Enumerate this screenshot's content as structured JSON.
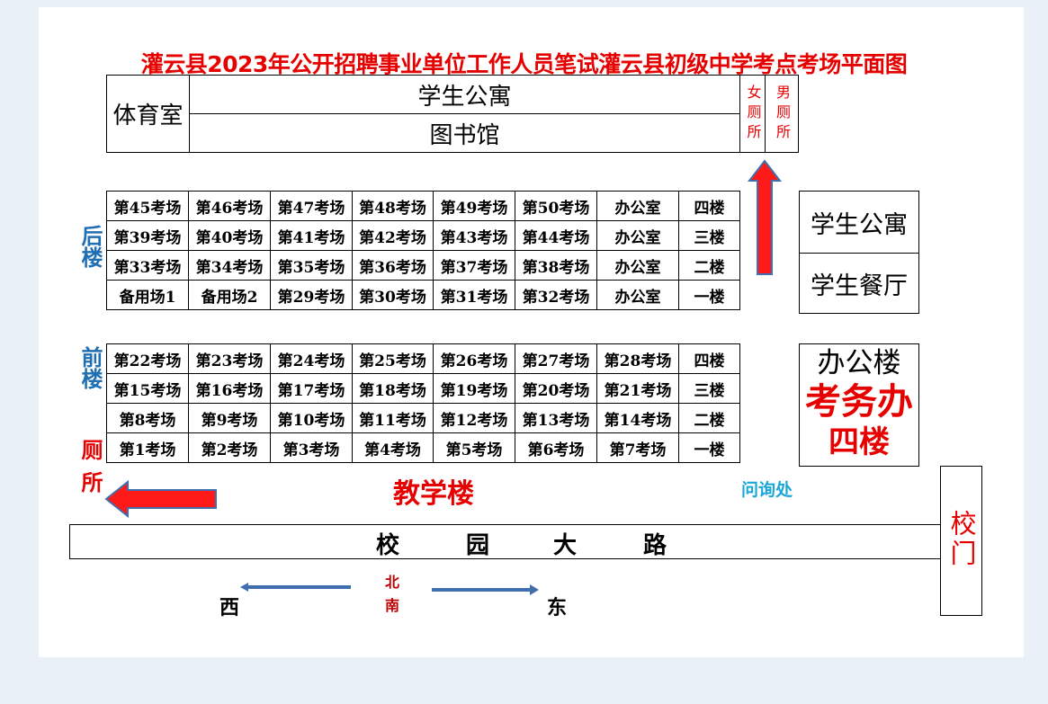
{
  "title": "灌云县2023年公开招聘事业单位工作人员笔试灌云县初级中学考点考场平面图",
  "top_block": {
    "gym": "体育室",
    "dorm": "学生公寓",
    "library": "图书馆",
    "female_restroom": "女厕所",
    "male_restroom": "男厕所"
  },
  "back_building": {
    "label": "后楼",
    "rows": [
      [
        "第45考场",
        "第46考场",
        "第47考场",
        "第48考场",
        "第49考场",
        "第50考场",
        "办公室",
        "四楼"
      ],
      [
        "第39考场",
        "第40考场",
        "第41考场",
        "第42考场",
        "第43考场",
        "第44考场",
        "办公室",
        "三楼"
      ],
      [
        "第33考场",
        "第34考场",
        "第35考场",
        "第36考场",
        "第37考场",
        "第38考场",
        "办公室",
        "二楼"
      ],
      [
        "备用场1",
        "备用场2",
        "第29考场",
        "第30考场",
        "第31考场",
        "第32考场",
        "办公室",
        "一楼"
      ]
    ]
  },
  "front_building": {
    "label": "前楼",
    "rows": [
      [
        "第22考场",
        "第23考场",
        "第24考场",
        "第25考场",
        "第26考场",
        "第27考场",
        "第28考场",
        "四楼"
      ],
      [
        "第15考场",
        "第16考场",
        "第17考场",
        "第18考场",
        "第19考场",
        "第20考场",
        "第21考场",
        "三楼"
      ],
      [
        "第8考场",
        "第9考场",
        "第10考场",
        "第11考场",
        "第12考场",
        "第13考场",
        "第14考场",
        "二楼"
      ],
      [
        "第1考场",
        "第2考场",
        "第3考场",
        "第4考场",
        "第5考场",
        "第6考场",
        "第7考场",
        "一楼"
      ]
    ]
  },
  "restroom_label": "厕所",
  "teaching_building": "教学楼",
  "inquiry": "问询处",
  "right_top": {
    "dorm": "学生公寓",
    "canteen": "学生餐厅"
  },
  "office_building": {
    "name": "办公楼",
    "exam_office": "考务办",
    "floor": "四楼"
  },
  "road": [
    "校",
    "园",
    "大",
    "路"
  ],
  "gate": "校门",
  "compass": {
    "west": "西",
    "east": "东",
    "north": "北",
    "south": "南"
  },
  "colors": {
    "red": "#e60000",
    "blue": "#1f6fb2",
    "cyan": "#1aa7d8",
    "compass_red": "#c00000",
    "arrow_blue": "#3f6fb0"
  }
}
